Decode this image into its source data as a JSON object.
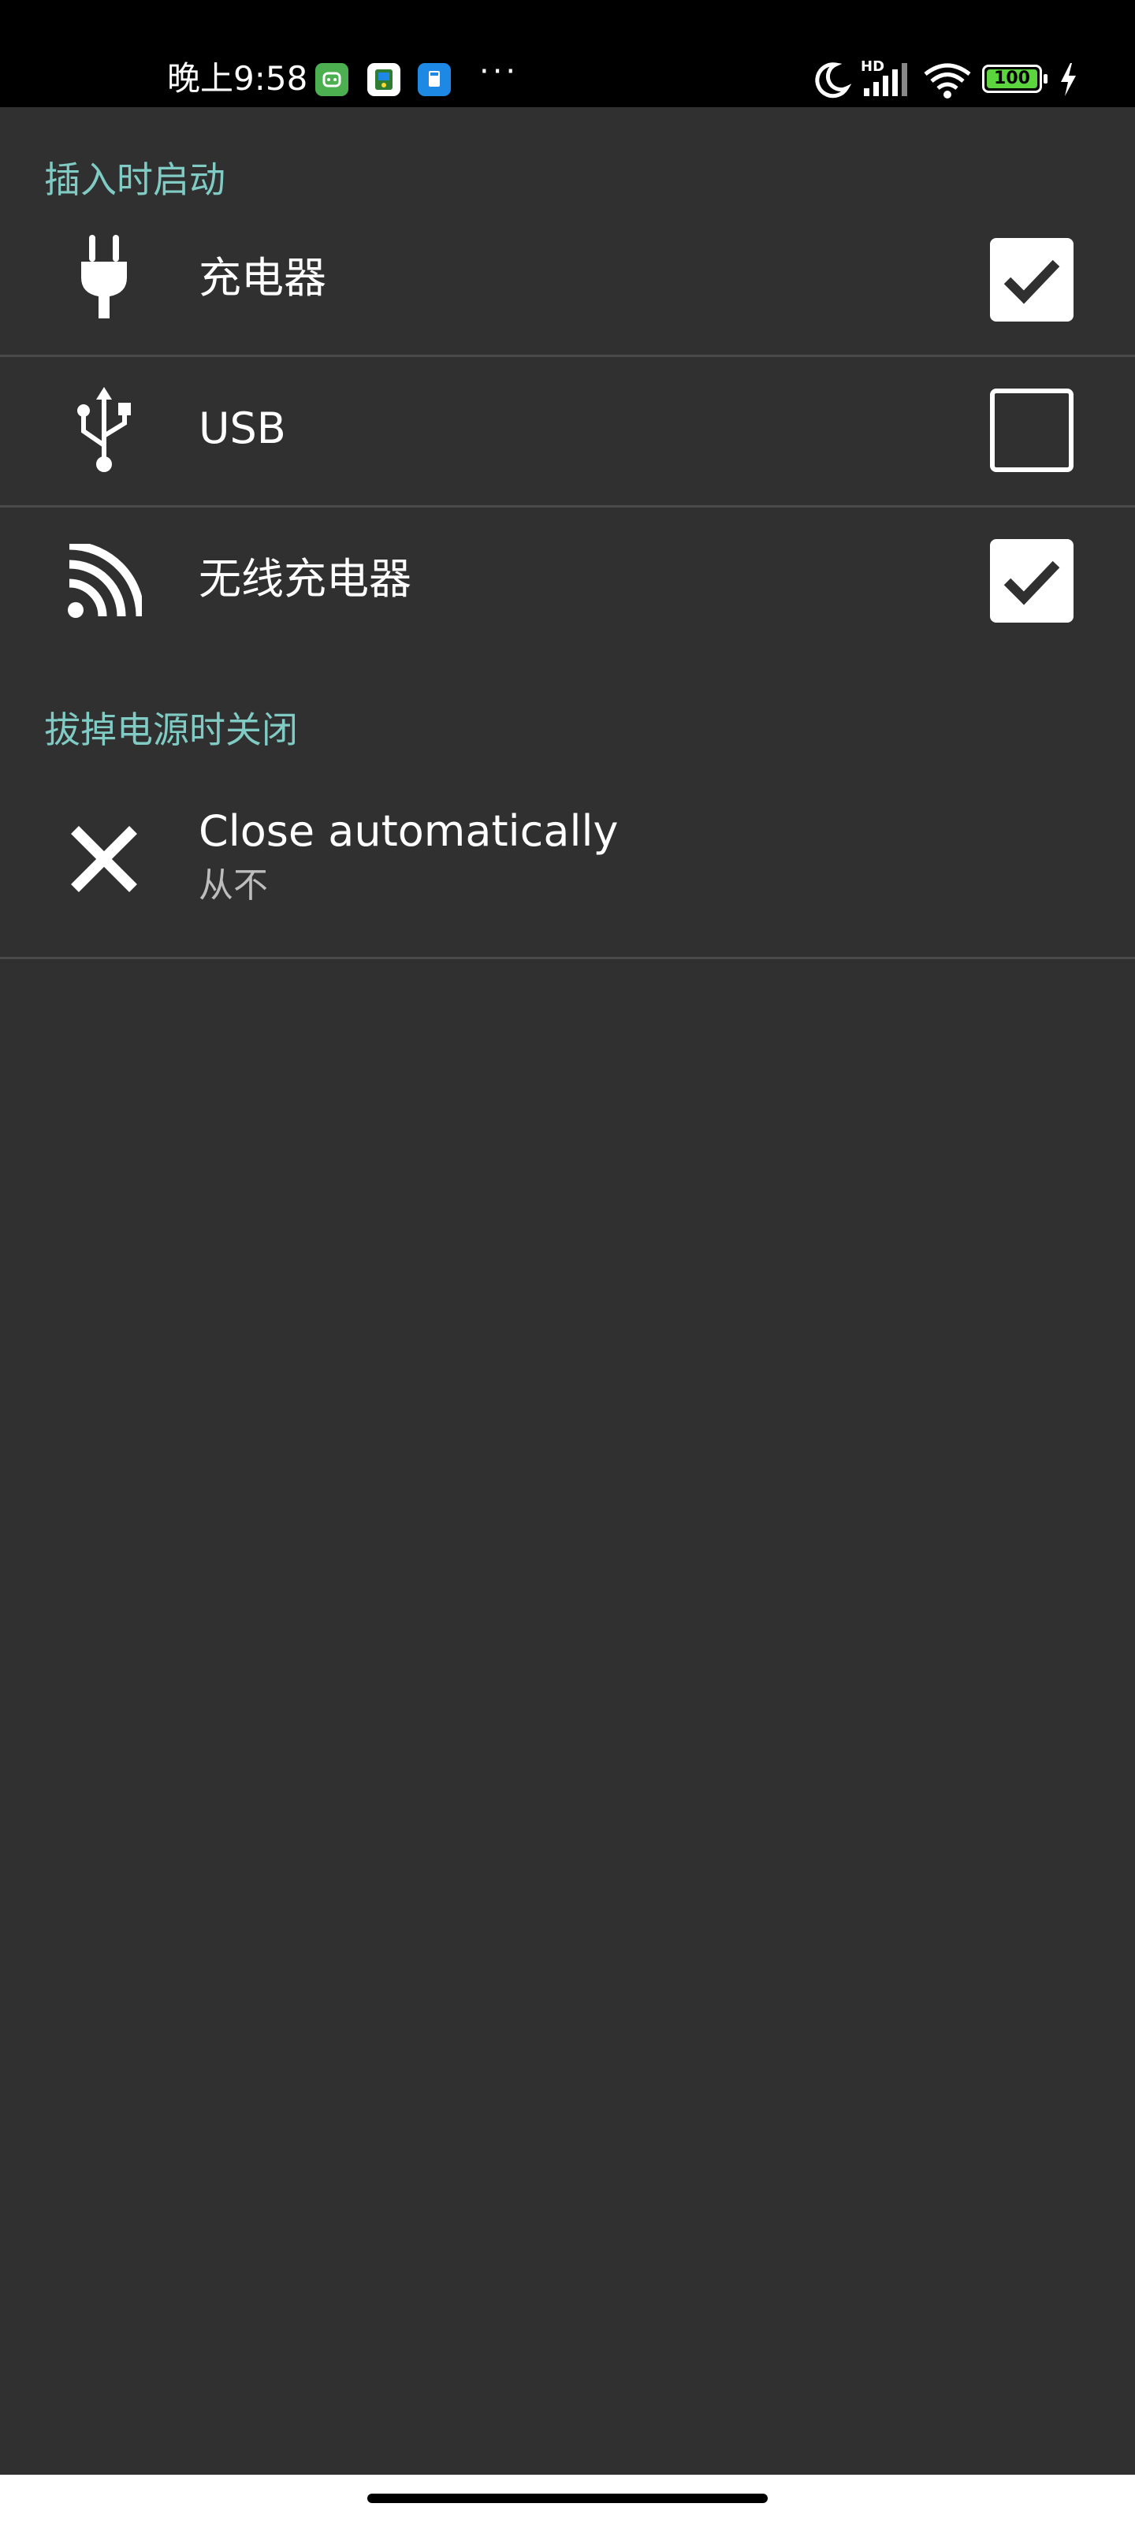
{
  "status_bar": {
    "time": "晚上9:58",
    "battery_level": "100",
    "icons": [
      "green-app-icon",
      "map-app-icon",
      "blue-app-icon",
      "more-dots-icon",
      "moon-icon",
      "hd-signal-icon",
      "wifi-icon",
      "battery-icon",
      "charging-bolt-icon"
    ],
    "more": "···"
  },
  "sections": [
    {
      "header": "插入时启动",
      "items": [
        {
          "title": "充电器",
          "icon": "plug-icon",
          "checked": true
        },
        {
          "title": "USB",
          "icon": "usb-icon",
          "checked": false
        },
        {
          "title": "无线充电器",
          "icon": "wireless-charging-icon",
          "checked": true
        }
      ]
    },
    {
      "header": "拔掉电源时关闭",
      "items": [
        {
          "title": "Close automatically",
          "summary": "从不",
          "icon": "close-icon"
        }
      ]
    }
  ],
  "colors": {
    "background": "#303030",
    "accent": "#80cbc4",
    "divider": "#4a4a4a",
    "battery": "#5bd43d"
  }
}
